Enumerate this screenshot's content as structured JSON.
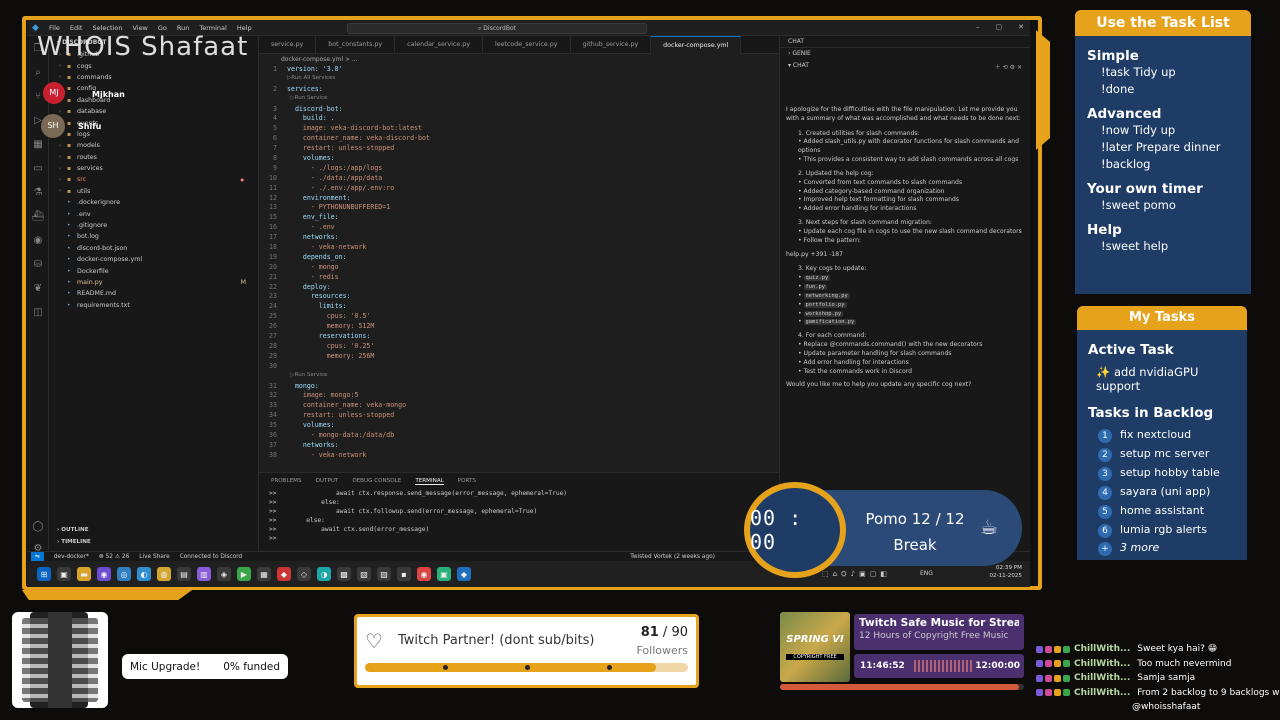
{
  "stream_title": "WHOIS Shafaat",
  "vscode": {
    "menu": [
      "File",
      "Edit",
      "Selection",
      "View",
      "Go",
      "Run",
      "Terminal",
      "Help"
    ],
    "search": "DiscordBot",
    "explorer": {
      "header": "DISCORDBOT",
      "items": [
        {
          "name": ".github",
          "type": "folder"
        },
        {
          "name": "cogs",
          "type": "folder"
        },
        {
          "name": "commands",
          "type": "folder"
        },
        {
          "name": "config",
          "type": "folder"
        },
        {
          "name": "dashboard",
          "type": "folder"
        },
        {
          "name": "database",
          "type": "folder"
        },
        {
          "name": "events",
          "type": "folder"
        },
        {
          "name": "logs",
          "type": "folder"
        },
        {
          "name": "models",
          "type": "folder"
        },
        {
          "name": "routes",
          "type": "folder"
        },
        {
          "name": "services",
          "type": "folder"
        },
        {
          "name": "src",
          "type": "folder",
          "status": "red"
        },
        {
          "name": "utils",
          "type": "folder"
        },
        {
          "name": ".dockerignore",
          "type": "file"
        },
        {
          "name": ".env",
          "type": "file"
        },
        {
          "name": ".gitignore",
          "type": "file"
        },
        {
          "name": "bot.log",
          "type": "file"
        },
        {
          "name": "discord-bot.json",
          "type": "file"
        },
        {
          "name": "docker-compose.yml",
          "type": "file"
        },
        {
          "name": "Dockerfile",
          "type": "file"
        },
        {
          "name": "main.py",
          "type": "file",
          "badge": "M"
        },
        {
          "name": "README.md",
          "type": "file"
        },
        {
          "name": "requirements.txt",
          "type": "file"
        }
      ],
      "outline": "OUTLINE",
      "timeline": "TIMELINE"
    },
    "viewers": [
      {
        "name": "Mjkhan",
        "initials": "MJ"
      },
      {
        "name": "Shifu",
        "initials": "SH"
      }
    ],
    "tabs": [
      "service.py",
      "bot_constants.py",
      "calendar_service.py",
      "leetcode_service.py",
      "github_service.py",
      "docker-compose.yml"
    ],
    "active_tab": "docker-compose.yml",
    "breadcrumb": "docker-compose.yml > ...",
    "code": [
      {
        "n": "1",
        "t": "version: '3.8'",
        "c": "k"
      },
      {
        "n": "",
        "t": "▷Run All Services",
        "c": "c"
      },
      {
        "n": "2",
        "t": "services:",
        "c": "k"
      },
      {
        "n": "",
        "t": "  ▷Run Service",
        "c": "c"
      },
      {
        "n": "3",
        "t": "  discord-bot:",
        "c": "k"
      },
      {
        "n": "4",
        "t": "    build: .",
        "c": "k"
      },
      {
        "n": "5",
        "t": "    image: veka-discord-bot:latest",
        "c": "s"
      },
      {
        "n": "6",
        "t": "    container_name: veka-discord-bot",
        "c": "s"
      },
      {
        "n": "7",
        "t": "    restart: unless-stopped",
        "c": "s"
      },
      {
        "n": "8",
        "t": "    volumes:",
        "c": "k"
      },
      {
        "n": "9",
        "t": "      - ./logs:/app/logs",
        "c": "s"
      },
      {
        "n": "10",
        "t": "      - ./data:/app/data",
        "c": "s"
      },
      {
        "n": "11",
        "t": "      - ./.env:/app/.env:ro",
        "c": "s"
      },
      {
        "n": "12",
        "t": "    environment:",
        "c": "k"
      },
      {
        "n": "13",
        "t": "      - PYTHONUNBUFFERED=1",
        "c": "s"
      },
      {
        "n": "15",
        "t": "    env_file:",
        "c": "k"
      },
      {
        "n": "16",
        "t": "      - .env",
        "c": "s"
      },
      {
        "n": "17",
        "t": "    networks:",
        "c": "k"
      },
      {
        "n": "18",
        "t": "      - veka-network",
        "c": "s"
      },
      {
        "n": "19",
        "t": "    depends_on:",
        "c": "k"
      },
      {
        "n": "20",
        "t": "      - mongo",
        "c": "s"
      },
      {
        "n": "21",
        "t": "      - redis",
        "c": "s"
      },
      {
        "n": "22",
        "t": "    deploy:",
        "c": "k"
      },
      {
        "n": "23",
        "t": "      resources:",
        "c": "k"
      },
      {
        "n": "24",
        "t": "        limits:",
        "c": "k"
      },
      {
        "n": "25",
        "t": "          cpus: '0.5'",
        "c": "s"
      },
      {
        "n": "26",
        "t": "          memory: 512M",
        "c": "s"
      },
      {
        "n": "27",
        "t": "        reservations:",
        "c": "k"
      },
      {
        "n": "28",
        "t": "          cpus: '0.25'",
        "c": "s"
      },
      {
        "n": "29",
        "t": "          memory: 256M",
        "c": "s"
      },
      {
        "n": "30",
        "t": "",
        "c": "k"
      },
      {
        "n": "",
        "t": "  ▷Run Service",
        "c": "c"
      },
      {
        "n": "31",
        "t": "  mongo:",
        "c": "k"
      },
      {
        "n": "32",
        "t": "    image: mongo:5",
        "c": "s"
      },
      {
        "n": "33",
        "t": "    container_name: veka-mongo",
        "c": "s"
      },
      {
        "n": "34",
        "t": "    restart: unless-stopped",
        "c": "s"
      },
      {
        "n": "35",
        "t": "    volumes:",
        "c": "k"
      },
      {
        "n": "36",
        "t": "      - mongo-data:/data/db",
        "c": "s"
      },
      {
        "n": "37",
        "t": "    networks:",
        "c": "k"
      },
      {
        "n": "38",
        "t": "      - veka-network",
        "c": "s"
      }
    ],
    "panel_tabs": [
      "PROBLEMS",
      "OUTPUT",
      "DEBUG CONSOLE",
      "TERMINAL",
      "PORTS"
    ],
    "terminal": [
      ">>                await ctx.response.send_message(error_message, ephemeral=True)",
      ">>            else:",
      ">>                await ctx.followup.send(error_message, ephemeral=True)",
      ">>        else:",
      ">>            await ctx.send(error_message)",
      ">>"
    ],
    "chat": {
      "title": "CHAT",
      "section1": "GENIE",
      "section2": "CHAT",
      "intro": "I apologize for the difficulties with the file manipulation. Let me provide you with a summary of what was accomplished and what needs to be done next:",
      "s1_title": "1. Created utilities for slash commands:",
      "s1_items": [
        "Added slash_utils.py with decorator functions for slash commands and options",
        "This provides a consistent way to add slash commands across all cogs"
      ],
      "s2_title": "2. Updated the help cog:",
      "s2_items": [
        "Converted from text commands to slash commands",
        "Added category-based command organization",
        "Improved help text formatting for slash commands",
        "Added error handling for interactions"
      ],
      "s3_title": "3. Next steps for slash command migration:",
      "s3_items": [
        "Update each cog file in cogs to use the new slash command decorators",
        "Follow the pattern:"
      ],
      "diff": "help.py +391 -187",
      "s4_title": "3. Key cogs to update:",
      "s4_items": [
        "quiz.py",
        "fun.py",
        "networking.py",
        "portfolio.py",
        "workshop.py",
        "gamification.py"
      ],
      "s5_title": "4. For each command:",
      "s5_items": [
        "Replace @commands.command() with the new decorators",
        "Update parameter handling for slash commands",
        "Add error handling for interactions",
        "Test the commands work in Discord"
      ],
      "question": "Would you like me to help you update any specific cog next?"
    },
    "status": {
      "remote": "dev-docker*",
      "errors": "52",
      "warnings": "26",
      "live_share": "Live Share",
      "discord": "Connected to Discord",
      "git_blame": "Twisted Vortek (2 weeks ago)"
    },
    "taskbar": {
      "time": "02:39 PM",
      "date": "02-11-2025",
      "lang": "ENG"
    }
  },
  "pomo": {
    "time": "00 : 00",
    "label": "Pomo",
    "count": "12 / 12",
    "state": "Break"
  },
  "task_list": {
    "title": "Use the Task List",
    "sections": [
      {
        "heading": "Simple",
        "cmds": [
          "!task Tidy up",
          "!done"
        ]
      },
      {
        "heading": "Advanced",
        "cmds": [
          "!now Tidy up",
          "!later Prepare dinner",
          "!backlog"
        ]
      },
      {
        "heading": "Your own timer",
        "cmds": [
          "!sweet pomo"
        ]
      },
      {
        "heading": "Help",
        "cmds": [
          "!sweet help"
        ]
      }
    ]
  },
  "my_tasks": {
    "title": "My Tasks",
    "active_heading": "Active Task",
    "active": "✨ add nvidiaGPU support",
    "backlog_heading": "Tasks in Backlog",
    "backlog": [
      {
        "n": "1",
        "t": "fix nextcloud"
      },
      {
        "n": "2",
        "t": "setup mc server"
      },
      {
        "n": "3",
        "t": "setup hobby table"
      },
      {
        "n": "4",
        "t": "sayara (uni app)"
      },
      {
        "n": "5",
        "t": "home assistant"
      },
      {
        "n": "6",
        "t": "lumia rgb alerts"
      }
    ],
    "more": "3 more",
    "more_icon": "+"
  },
  "mic_goal": {
    "label": "Mic Upgrade!",
    "funded": "0% funded"
  },
  "goal": {
    "title": "Twitch Partner! (dont sub/bits)",
    "current": "81",
    "target": "90",
    "unit": "Followers",
    "progress": 0.9
  },
  "music": {
    "art_text": "SPRING VI",
    "art_sub": "COPYRIGHT FREE",
    "title": "Twitch Safe Music for Stream",
    "subtitle": "12 Hours of Copyright Free Music",
    "elapsed": "11:46:52",
    "total": "12:00:00",
    "progress": 0.98
  },
  "chat_feed": [
    {
      "user": "ChillWith...",
      "msg": "Sweet kya hai? 😁"
    },
    {
      "user": "ChillWith...",
      "msg": "Too much nevermind"
    },
    {
      "user": "ChillWith...",
      "msg": "Samja samja"
    },
    {
      "user": "ChillWith...",
      "msg": "From 2 backlog to 9 backlogs wow"
    },
    {
      "user": "",
      "msg": "@whoisshafaat"
    }
  ],
  "colors": {
    "accent": "#e7a21c",
    "card": "#1f3c66",
    "vscode_blue": "#0078d4"
  }
}
